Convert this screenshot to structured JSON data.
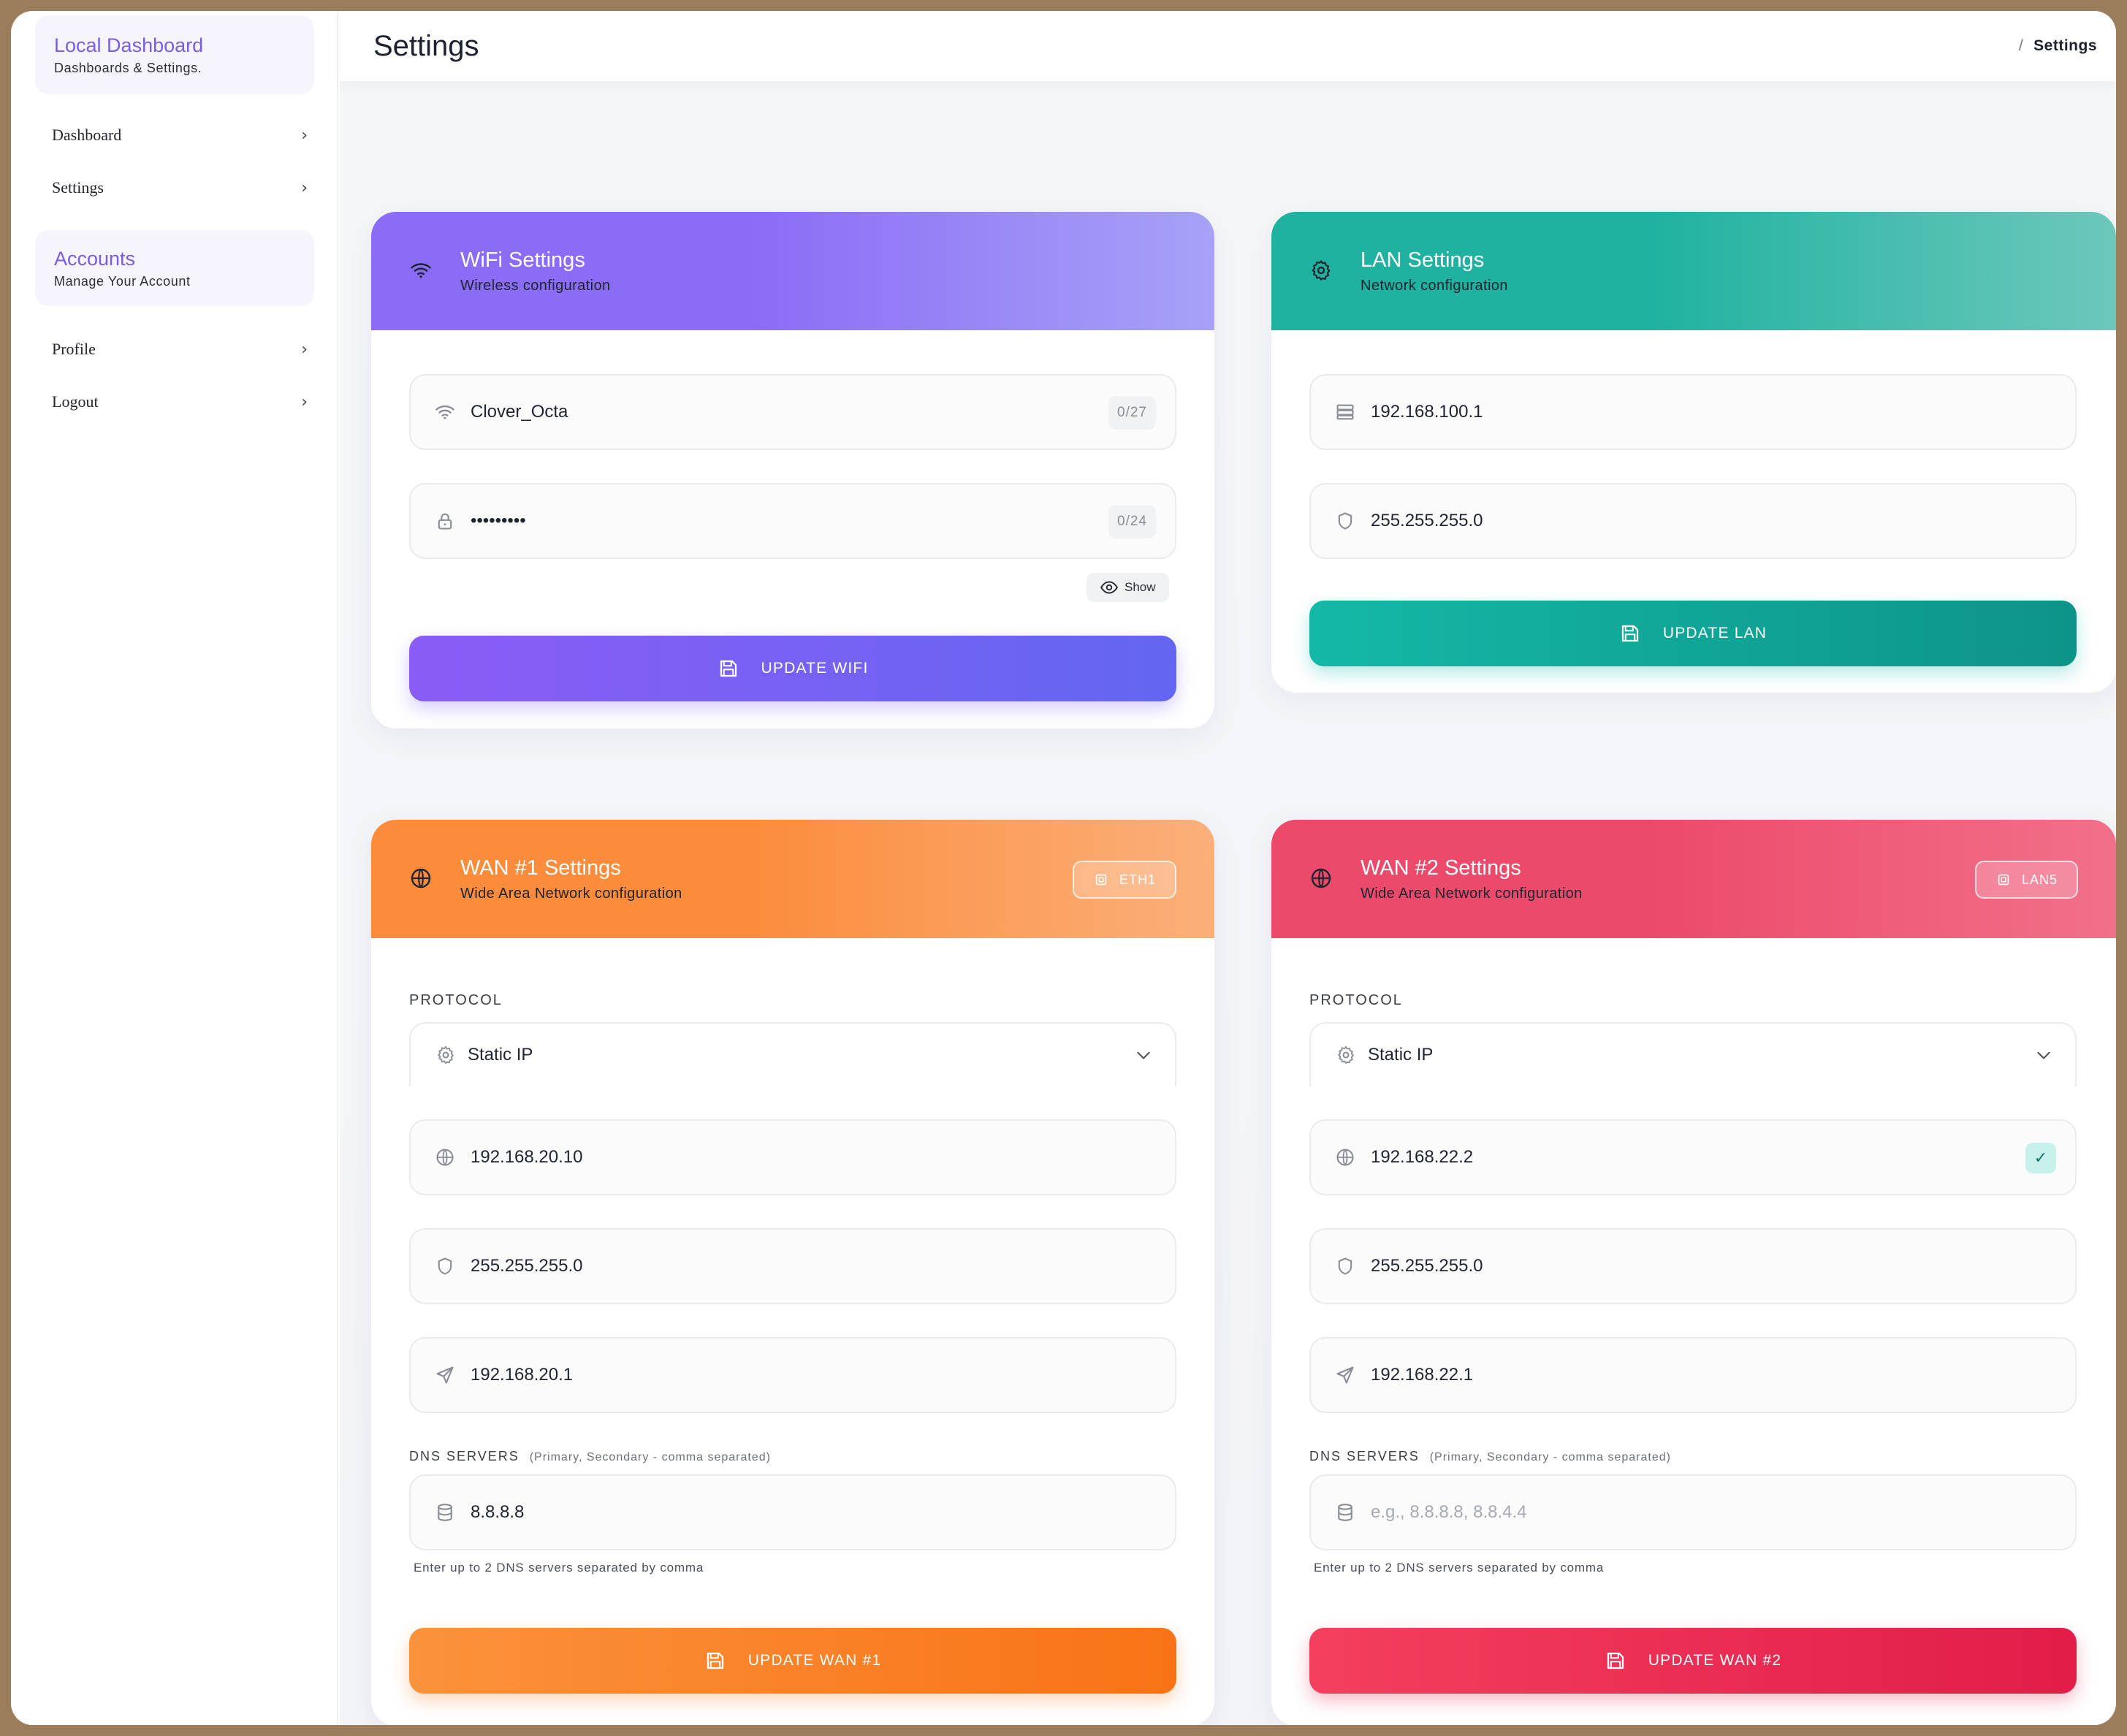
{
  "sidebar": {
    "brand": {
      "title": "Local Dashboard",
      "subtitle": "Dashboards & Settings."
    },
    "nav_main": [
      {
        "label": "Dashboard"
      },
      {
        "label": "Settings"
      }
    ],
    "section": {
      "title": "Accounts",
      "subtitle": "Manage Your Account"
    },
    "nav_account": [
      {
        "label": "Profile"
      },
      {
        "label": "Logout"
      }
    ],
    "chevron": "›"
  },
  "header": {
    "title": "Settings",
    "breadcrumb_sep": "/",
    "breadcrumb_current": "Settings"
  },
  "wifi": {
    "title": "WiFi Settings",
    "subtitle": "Wireless configuration",
    "ssid": {
      "value": "Clover_Octa",
      "counter": "0/27",
      "icon": "wifi-icon"
    },
    "password": {
      "value": "•••••••••",
      "counter": "0/24",
      "icon": "lock-icon"
    },
    "show_label": "Show",
    "button_label": "UPDATE WIFI",
    "colors": {
      "from": "#8b6cf6",
      "to": "#a7a2f7",
      "button_from": "#8b5cf6",
      "button_to": "#6366f1"
    }
  },
  "lan": {
    "title": "LAN Settings",
    "subtitle": "Network configuration",
    "ip": {
      "value": "192.168.100.1",
      "icon": "server-icon"
    },
    "netmask": {
      "value": "255.255.255.0",
      "icon": "shield-icon"
    },
    "button_label": "UPDATE LAN",
    "colors": {
      "from": "#20b2a0",
      "to": "#6cc8bb",
      "button_from": "#14b8a6",
      "button_to": "#0d9488"
    }
  },
  "wan1": {
    "title": "WAN #1 Settings",
    "subtitle": "Wide Area Network configuration",
    "badge": "ETH1",
    "protocol_label": "PROTOCOL",
    "protocol_value": "Static IP",
    "ip": "192.168.20.10",
    "netmask": "255.255.255.0",
    "gateway": "192.168.20.1",
    "dns_label": "DNS SERVERS",
    "dns_note": "(Primary, Secondary - comma separated)",
    "dns_value": "8.8.8.8",
    "dns_hint": "Enter up to 2 DNS servers separated by comma",
    "button_label": "UPDATE WAN #1",
    "colors": {
      "from": "#fb8c3c",
      "to": "#fbb07a",
      "button_from": "#fb923c",
      "button_to": "#f97316"
    }
  },
  "wan2": {
    "title": "WAN #2 Settings",
    "subtitle": "Wide Area Network configuration",
    "badge": "LAN5",
    "protocol_label": "PROTOCOL",
    "protocol_value": "Static IP",
    "ip": "192.168.22.2",
    "ip_check": "✓",
    "netmask": "255.255.255.0",
    "gateway": "192.168.22.1",
    "dns_label": "DNS SERVERS",
    "dns_note": "(Primary, Secondary - comma separated)",
    "dns_placeholder": "e.g., 8.8.8.8, 8.8.4.4",
    "dns_hint": "Enter up to 2 DNS servers separated by comma",
    "button_label": "UPDATE WAN #2",
    "colors": {
      "from": "#ec4a6a",
      "to": "#f2708a",
      "button_from": "#f43f5e",
      "button_to": "#e11d48"
    }
  }
}
